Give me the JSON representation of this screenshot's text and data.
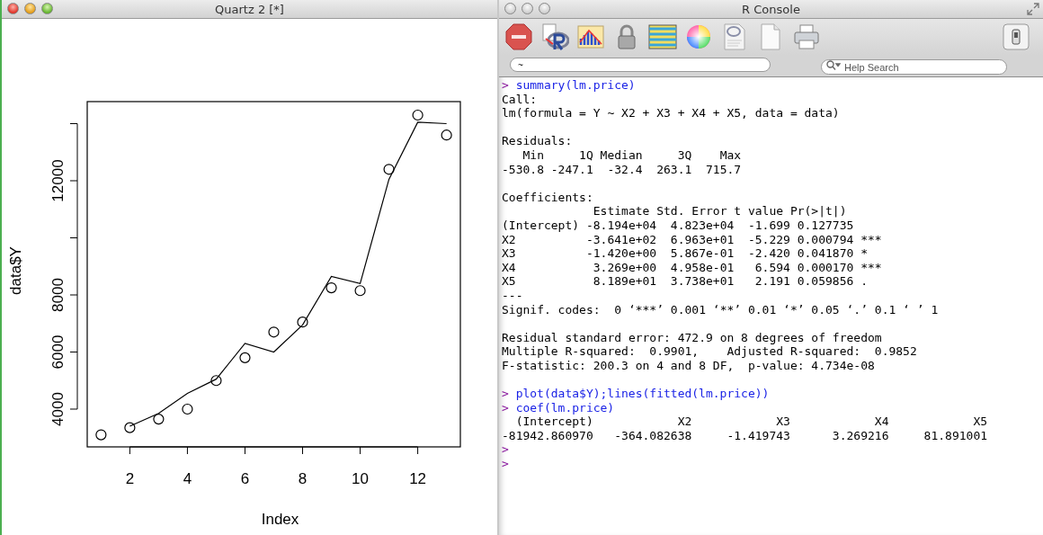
{
  "plot_window": {
    "title": "Quartz 2 [*]",
    "chart_data": {
      "type": "scatter",
      "xlabel": "Index",
      "ylabel": "data$Y",
      "x": [
        1,
        2,
        3,
        4,
        5,
        6,
        7,
        8,
        9,
        10,
        11,
        12,
        13
      ],
      "xlim": [
        0.52,
        13.48
      ],
      "ylim": [
        2677,
        14772
      ],
      "xticks": [
        2,
        4,
        6,
        8,
        10,
        12
      ],
      "yticks": [
        4000,
        6000,
        8000,
        {
          "value": 10000,
          "label": null
        },
        12000,
        {
          "value": 14000,
          "label": null
        }
      ],
      "series": [
        {
          "type": "scatter",
          "color": "#000000",
          "values": [
            3100,
            3350,
            3650,
            4000,
            5000,
            5800,
            6700,
            7050,
            8250,
            8150,
            12400,
            14300,
            13600
          ]
        },
        {
          "type": "line",
          "color": "#000000",
          "values": [
            null,
            3400,
            3850,
            4550,
            5050,
            6300,
            6000,
            6950,
            8650,
            8400,
            12050,
            14050,
            14000
          ]
        }
      ]
    }
  },
  "console_window": {
    "title": "R Console",
    "working_directory": "~",
    "help_search": {
      "placeholder": "Help Search"
    },
    "lines": [
      {
        "kind": "input",
        "prompt": ">",
        "text": "summary(lm.price)"
      },
      {
        "kind": "output",
        "text": "Call:"
      },
      {
        "kind": "output",
        "text": "lm(formula = Y ~ X2 + X3 + X4 + X5, data = data)"
      },
      {
        "kind": "blank"
      },
      {
        "kind": "output",
        "text": "Residuals:"
      },
      {
        "kind": "output",
        "text": "   Min     1Q Median     3Q    Max"
      },
      {
        "kind": "output",
        "text": "-530.8 -247.1  -32.4  263.1  715.7"
      },
      {
        "kind": "blank"
      },
      {
        "kind": "output",
        "text": "Coefficients:"
      },
      {
        "kind": "output",
        "text": "             Estimate Std. Error t value Pr(>|t|)"
      },
      {
        "kind": "output",
        "text": "(Intercept) -8.194e+04  4.823e+04  -1.699 0.127735"
      },
      {
        "kind": "output",
        "text": "X2          -3.641e+02  6.963e+01  -5.229 0.000794 ***"
      },
      {
        "kind": "output",
        "text": "X3          -1.420e+00  5.867e-01  -2.420 0.041870 *"
      },
      {
        "kind": "output",
        "text": "X4           3.269e+00  4.958e-01   6.594 0.000170 ***"
      },
      {
        "kind": "output",
        "text": "X5           8.189e+01  3.738e+01   2.191 0.059856 ."
      },
      {
        "kind": "output",
        "text": "---"
      },
      {
        "kind": "output",
        "text": "Signif. codes:  0 ‘***’ 0.001 ‘**’ 0.01 ‘*’ 0.05 ‘.’ 0.1 ‘ ’ 1"
      },
      {
        "kind": "blank"
      },
      {
        "kind": "output",
        "text": "Residual standard error: 472.9 on 8 degrees of freedom"
      },
      {
        "kind": "output",
        "text": "Multiple R-squared:  0.9901,    Adjusted R-squared:  0.9852"
      },
      {
        "kind": "output",
        "text": "F-statistic: 200.3 on 4 and 8 DF,  p-value: 4.734e-08"
      },
      {
        "kind": "blank"
      },
      {
        "kind": "input",
        "prompt": ">",
        "text": "plot(data$Y);lines(fitted(lm.price))"
      },
      {
        "kind": "input",
        "prompt": ">",
        "text": "coef(lm.price)"
      },
      {
        "kind": "output",
        "text": "  (Intercept)            X2            X3            X4            X5"
      },
      {
        "kind": "output",
        "text": "-81942.860970   -364.082638     -1.419743      3.269216     81.891001"
      },
      {
        "kind": "input",
        "prompt": ">"
      },
      {
        "kind": "input",
        "prompt": ">"
      }
    ]
  }
}
